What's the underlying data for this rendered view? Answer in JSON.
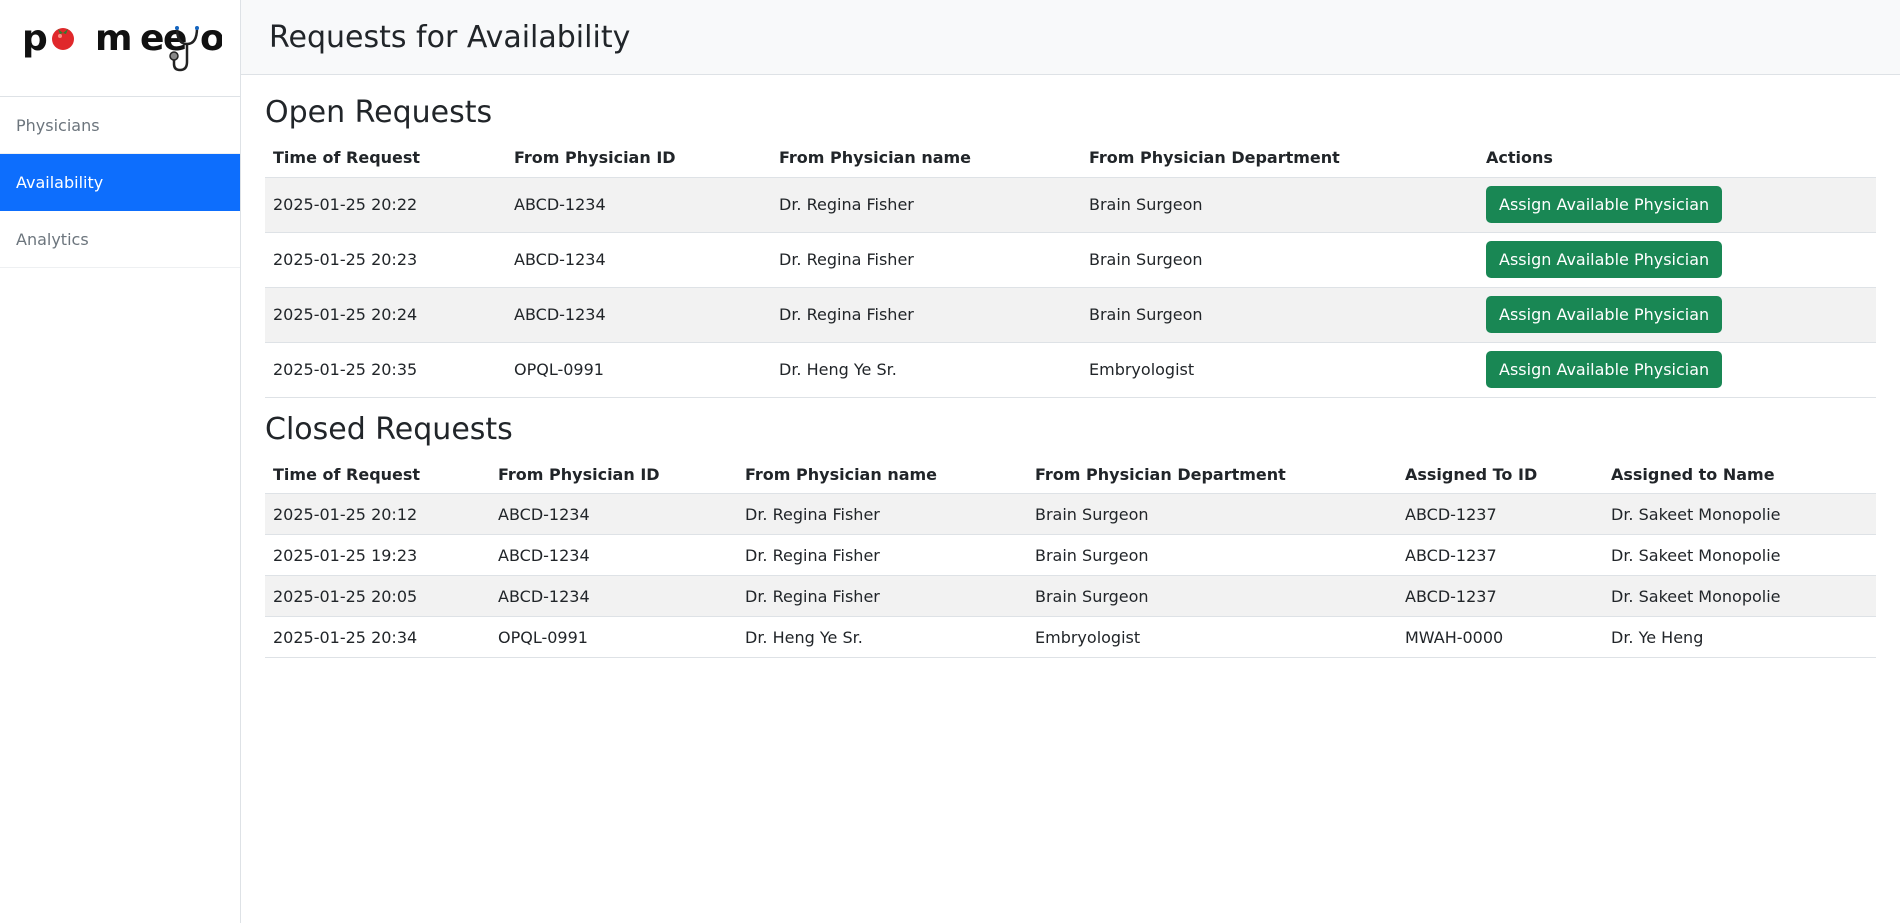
{
  "brand": {
    "name": "pomeeyo"
  },
  "sidebar": {
    "items": [
      {
        "label": "Physicians",
        "active": false
      },
      {
        "label": "Availability",
        "active": true
      },
      {
        "label": "Analytics",
        "active": false
      }
    ]
  },
  "header": {
    "title": "Requests for Availability"
  },
  "open_requests": {
    "title": "Open Requests",
    "columns": [
      "Time of Request",
      "From Physician ID",
      "From Physician name",
      "From Physician Department",
      "Actions"
    ],
    "action_label": "Assign Available Physician",
    "rows": [
      {
        "time": "2025-01-25 20:22",
        "id": "ABCD-1234",
        "name": "Dr. Regina Fisher",
        "department": "Brain Surgeon"
      },
      {
        "time": "2025-01-25 20:23",
        "id": "ABCD-1234",
        "name": "Dr. Regina Fisher",
        "department": "Brain Surgeon"
      },
      {
        "time": "2025-01-25 20:24",
        "id": "ABCD-1234",
        "name": "Dr. Regina Fisher",
        "department": "Brain Surgeon"
      },
      {
        "time": "2025-01-25 20:35",
        "id": "OPQL-0991",
        "name": "Dr. Heng Ye Sr.",
        "department": "Embryologist"
      }
    ]
  },
  "closed_requests": {
    "title": "Closed Requests",
    "columns": [
      "Time of Request",
      "From Physician ID",
      "From Physician name",
      "From Physician Department",
      "Assigned To ID",
      "Assigned to Name"
    ],
    "rows": [
      {
        "time": "2025-01-25 20:12",
        "id": "ABCD-1234",
        "name": "Dr. Regina Fisher",
        "department": "Brain Surgeon",
        "assigned_id": "ABCD-1237",
        "assigned_name": "Dr. Sakeet Monopolie"
      },
      {
        "time": "2025-01-25 19:23",
        "id": "ABCD-1234",
        "name": "Dr. Regina Fisher",
        "department": "Brain Surgeon",
        "assigned_id": "ABCD-1237",
        "assigned_name": "Dr. Sakeet Monopolie"
      },
      {
        "time": "2025-01-25 20:05",
        "id": "ABCD-1234",
        "name": "Dr. Regina Fisher",
        "department": "Brain Surgeon",
        "assigned_id": "ABCD-1237",
        "assigned_name": "Dr. Sakeet Monopolie"
      },
      {
        "time": "2025-01-25 20:34",
        "id": "OPQL-0991",
        "name": "Dr. Heng Ye Sr.",
        "department": "Embryologist",
        "assigned_id": "MWAH-0000",
        "assigned_name": "Dr. Ye Heng"
      }
    ]
  },
  "colors": {
    "primary": "#0d6efd",
    "success": "#198754",
    "stripe": "#f2f2f2",
    "logo_red": "#e0282b"
  }
}
